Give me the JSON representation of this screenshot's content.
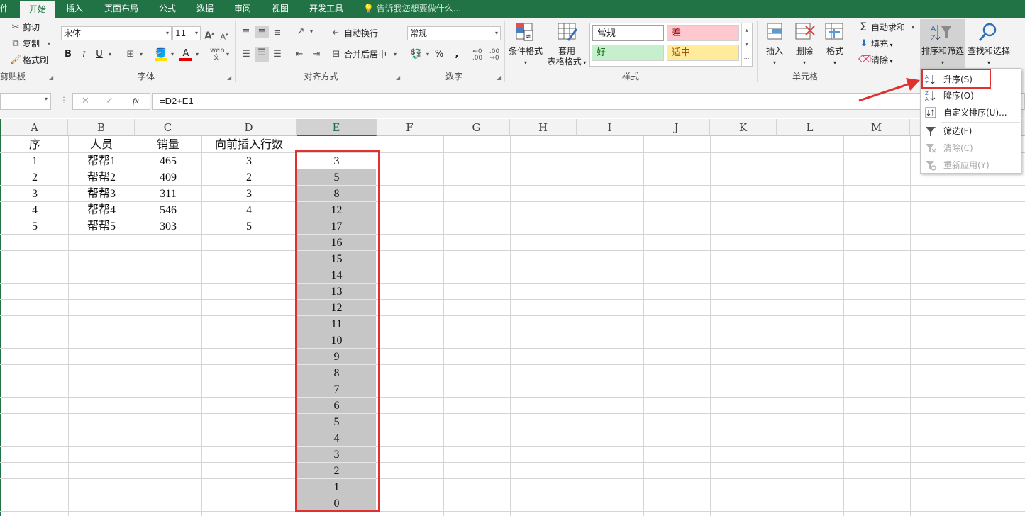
{
  "tabs": [
    {
      "label": "件",
      "active": false
    },
    {
      "label": "开始",
      "active": true
    },
    {
      "label": "插入",
      "active": false
    },
    {
      "label": "页面布局",
      "active": false
    },
    {
      "label": "公式",
      "active": false
    },
    {
      "label": "数据",
      "active": false
    },
    {
      "label": "审阅",
      "active": false
    },
    {
      "label": "视图",
      "active": false
    },
    {
      "label": "开发工具",
      "active": false
    }
  ],
  "tell_me": "告诉我您想要做什么...",
  "clipboard": {
    "cut": "剪切",
    "copy": "复制",
    "format_painter": "格式刷",
    "group": "剪贴板"
  },
  "font": {
    "name": "宋体",
    "size": "11",
    "bold": "B",
    "italic": "I",
    "underline": "U",
    "group": "字体",
    "phonetic": "wén"
  },
  "alignment": {
    "wrap": "自动换行",
    "merge": "合并后居中",
    "group": "对齐方式"
  },
  "number": {
    "format": "常规",
    "percent": "%",
    "comma": ",",
    "group": "数字"
  },
  "styles": {
    "conditional": "条件格式",
    "table_line1": "套用",
    "table_line2": "表格格式",
    "normal": "常规",
    "bad": "差",
    "good": "好",
    "neutral": "适中",
    "group": "样式"
  },
  "cells": {
    "insert": "插入",
    "delete": "删除",
    "format": "格式",
    "group": "单元格"
  },
  "editing": {
    "autosum": "自动求和",
    "fill": "填充",
    "clear": "清除",
    "sort_filter": "排序和筛选",
    "find_select": "查找和选择"
  },
  "formula_bar": {
    "cancel": "✕",
    "enter": "✓",
    "fx": "fx",
    "formula": "=D2+E1"
  },
  "columns": [
    "A",
    "B",
    "C",
    "D",
    "E",
    "F",
    "G",
    "H",
    "I",
    "J",
    "K",
    "L",
    "M"
  ],
  "selected_column": "E",
  "table": {
    "headers": [
      "序",
      "人员",
      "销量",
      "向前插入行数"
    ],
    "rows": [
      [
        "1",
        "帮帮1",
        "465",
        "3"
      ],
      [
        "2",
        "帮帮2",
        "409",
        "2"
      ],
      [
        "3",
        "帮帮3",
        "311",
        "3"
      ],
      [
        "4",
        "帮帮4",
        "546",
        "4"
      ],
      [
        "5",
        "帮帮5",
        "303",
        "5"
      ]
    ]
  },
  "column_e_values": [
    "3",
    "5",
    "8",
    "12",
    "17",
    "16",
    "15",
    "14",
    "13",
    "12",
    "11",
    "10",
    "9",
    "8",
    "7",
    "6",
    "5",
    "4",
    "3",
    "2",
    "1",
    "0"
  ],
  "sort_menu": {
    "items": [
      {
        "label": "升序(S)",
        "enabled": true,
        "icon": "sort-asc-icon"
      },
      {
        "label": "降序(O)",
        "enabled": true,
        "icon": "sort-desc-icon"
      },
      {
        "label": "自定义排序(U)...",
        "enabled": true,
        "icon": "custom-sort-icon"
      },
      {
        "label": "筛选(F)",
        "enabled": true,
        "icon": "filter-icon"
      },
      {
        "label": "清除(C)",
        "enabled": false,
        "icon": "clear-filter-icon"
      },
      {
        "label": "重新应用(Y)",
        "enabled": false,
        "icon": "reapply-icon"
      }
    ]
  },
  "colors": {
    "brand": "#217346",
    "highlight": "#e03030",
    "selection": "#c6c6c6"
  }
}
